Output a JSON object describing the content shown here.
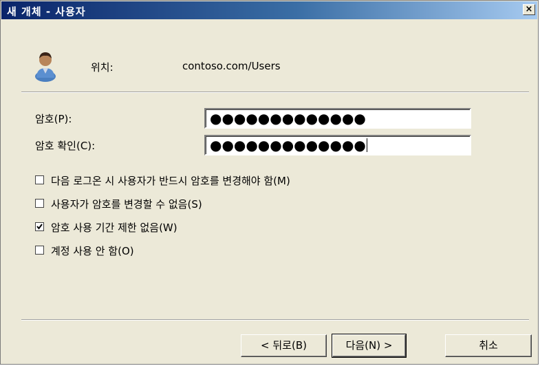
{
  "window": {
    "title": "새 개체 - 사용자",
    "close_glyph": "×"
  },
  "location": {
    "label": "위치:",
    "value": "contoso.com/Users"
  },
  "password": {
    "label": "암호(P):",
    "masked": "●●●●●●●●●●●●●"
  },
  "confirm": {
    "label": "암호 확인(C):",
    "masked": "●●●●●●●●●●●●●"
  },
  "options": [
    {
      "label": "다음 로그온 시 사용자가 반드시 암호를 변경해야 함(M)",
      "checked": false
    },
    {
      "label": "사용자가 암호를 변경할 수 없음(S)",
      "checked": false
    },
    {
      "label": "암호 사용 기간 제한 없음(W)",
      "checked": true
    },
    {
      "label": "계정 사용 안 함(O)",
      "checked": false
    }
  ],
  "buttons": {
    "back": "< 뒤로(B)",
    "next": "다음(N) >",
    "cancel": "취소"
  }
}
